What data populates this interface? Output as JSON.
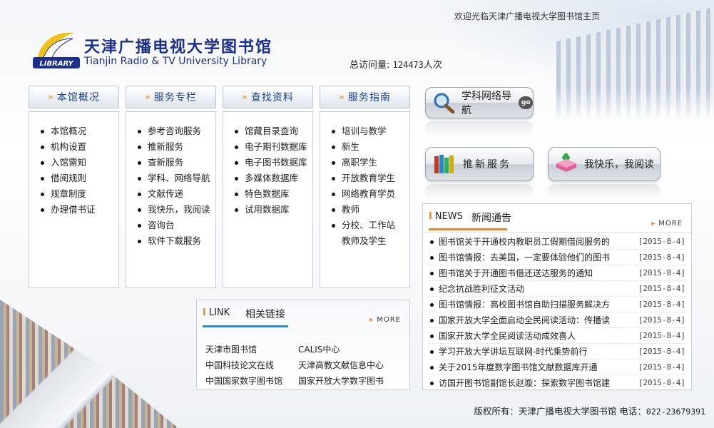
{
  "header": {
    "welcome": "欢迎光临天津广播电视大学图书馆主页",
    "logo_cn": "天津广播电视大学图书馆",
    "logo_en": "Tianjin Radio & TV University Library",
    "logo_badge": "LIBRARY",
    "visits_label": "总访问量:",
    "visits_count": "124473",
    "visits_unit": "人次"
  },
  "nav": [
    {
      "title": "本馆概况",
      "items": [
        "本馆概况",
        "机构设置",
        "入馆需知",
        "借阅规则",
        "规章制度",
        "办理借书证"
      ]
    },
    {
      "title": "服务专栏",
      "items": [
        "参考咨询服务",
        "推新服务",
        "查新服务",
        "学科、网络导航",
        "文献传递",
        "我快乐，我阅读",
        "咨询台",
        "软件下载服务"
      ]
    },
    {
      "title": "查找资料",
      "items": [
        "馆藏目录查询",
        "电子期刊数据库",
        "电子图书数据库",
        "多媒体数据库",
        "特色数据库",
        "试用数据库"
      ]
    },
    {
      "title": "服务指南",
      "items": [
        "培训与教学",
        "新生",
        "高职学生",
        "开放教育学生",
        "网络教育学员",
        "教师",
        "分校、工作站教师及学生"
      ]
    }
  ],
  "buttons": {
    "subject_nav": "学科网络导航",
    "go": "go",
    "recommend": "推新服务",
    "happy_reading": "我快乐，我阅读"
  },
  "news": {
    "tag_en": "NEWS",
    "tag_cn": "新闻通告",
    "more": "MORE",
    "items": [
      {
        "title": "图书馆关于开通校内教职员工假期借阅服务的",
        "date": "[2015-8-4]"
      },
      {
        "title": "图书馆情报：去美国，一定要体验他们的图书",
        "date": "[2015-8-4]"
      },
      {
        "title": "图书馆关于开通图书借还送达服务的通知",
        "date": "[2015-8-4]"
      },
      {
        "title": "纪念抗战胜利征文活动",
        "date": "[2015-8-4]"
      },
      {
        "title": "图书馆情报：高校图书馆自助扫描服务解决方",
        "date": "[2015-8-4]"
      },
      {
        "title": "国家开放大学全面启动全民阅读活动：传播读",
        "date": "[2015-8-4]"
      },
      {
        "title": "国家开放大学全民阅读活动成效喜人",
        "date": "[2015-8-4]"
      },
      {
        "title": "学习开放大学讲坛互联网-时代乘势前行",
        "date": "[2015-8-4]"
      },
      {
        "title": "关于2015年度数字图书馆文献数据库开通",
        "date": "[2015-8-4]"
      },
      {
        "title": "访国开图书馆副馆长赵璇：探索数字图书馆建",
        "date": "[2015-8-4]"
      }
    ]
  },
  "links": {
    "tag_en": "LINK",
    "tag_cn": "相关链接",
    "more": "MORE",
    "items": [
      "天津市图书馆",
      "CALIS中心",
      "中国科技论文在线",
      "天津高教文献信息中心",
      "中国国家数字图书馆",
      "国家开放大学数字图书"
    ]
  },
  "footer": {
    "copyright": "版权所有：天津广播电视大学图书馆",
    "tel_label": "电话：",
    "tel": "022-23679391"
  },
  "colors": {
    "accent": "#e08a2e",
    "brand": "#1c2f8c",
    "nav_text": "#1c3f8a"
  }
}
